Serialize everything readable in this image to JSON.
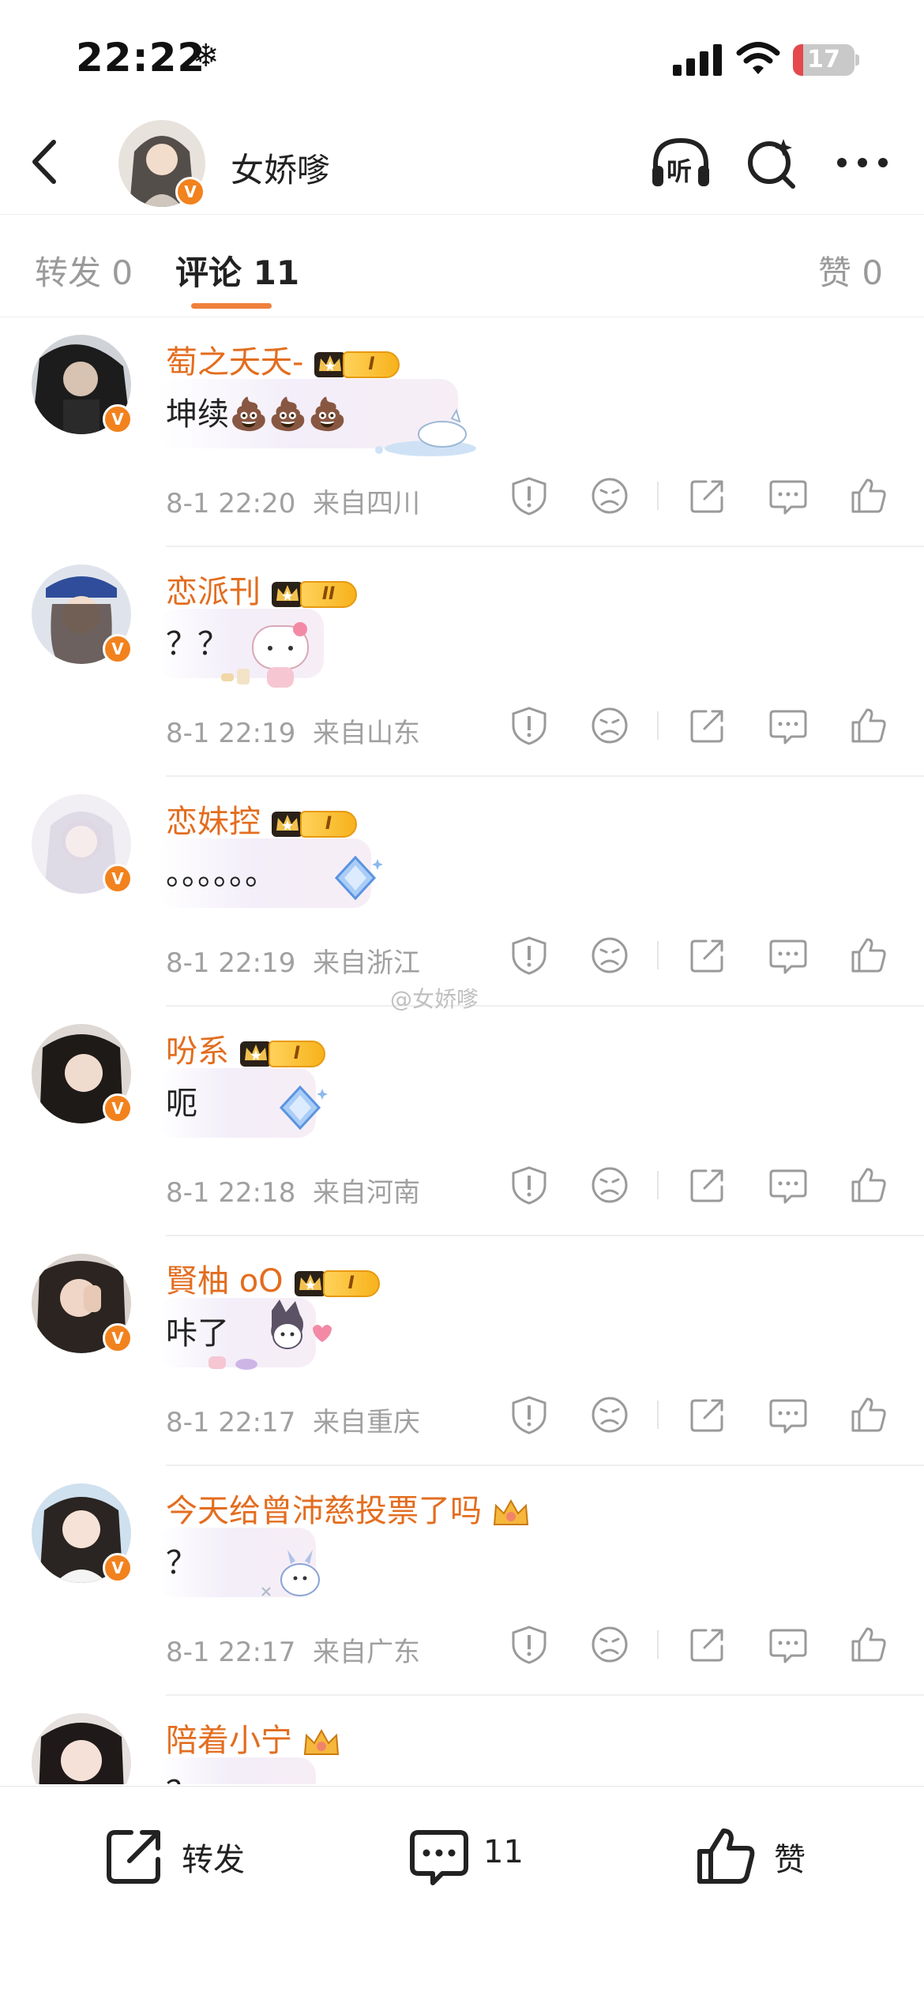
{
  "status_bar": {
    "time": "22:22",
    "battery": "17",
    "battery_level": 0.17
  },
  "nav": {
    "title": "女娇嗲",
    "listen_label": "听",
    "verified_mark": "V"
  },
  "tabs": [
    {
      "label": "转发 0"
    },
    {
      "label": "评论 11"
    },
    {
      "label": "赞 0"
    }
  ],
  "comments": [
    {
      "name": "萄之夭夭-",
      "level": "I",
      "text": "坤续💩💩💩",
      "time": "8-1 22:20",
      "location": "来自四川"
    },
    {
      "name": "恋派刊",
      "level": "II",
      "text": "？？",
      "time": "8-1 22:19",
      "location": "来自山东"
    },
    {
      "name": "恋妹控",
      "level": "I",
      "text": "。。。。。。",
      "time": "8-1 22:19",
      "location": "来自浙江"
    },
    {
      "name": "吩系",
      "level": "I",
      "text": "呃",
      "time": "8-1 22:18",
      "location": "来自河南"
    },
    {
      "name": "賢柚 oO",
      "level": "I",
      "text": "咔了",
      "time": "8-1 22:17",
      "location": "来自重庆"
    },
    {
      "name": "今天给曾沛慈投票了吗",
      "level": "",
      "text": "？",
      "time": "8-1 22:17",
      "location": "来自广东"
    },
    {
      "name": "陪着小宁",
      "level": "",
      "text": "？",
      "time": "",
      "location": ""
    }
  ],
  "watermark": "@女娇嗲",
  "bottom_bar": {
    "repost_label": "转发",
    "comment_count": "11",
    "like_label": "赞"
  },
  "colors": {
    "accent_orange": "#f0803c",
    "username_orange": "#e36d1f",
    "verified_badge": "#f2821d",
    "meta_gray": "#a0a0a0"
  },
  "icons": [
    "back-arrow-icon",
    "headphones-icon",
    "search-sparkle-icon",
    "more-icon",
    "report-icon",
    "frown-icon",
    "share-icon",
    "comment-icon",
    "like-icon",
    "crown-icon"
  ]
}
